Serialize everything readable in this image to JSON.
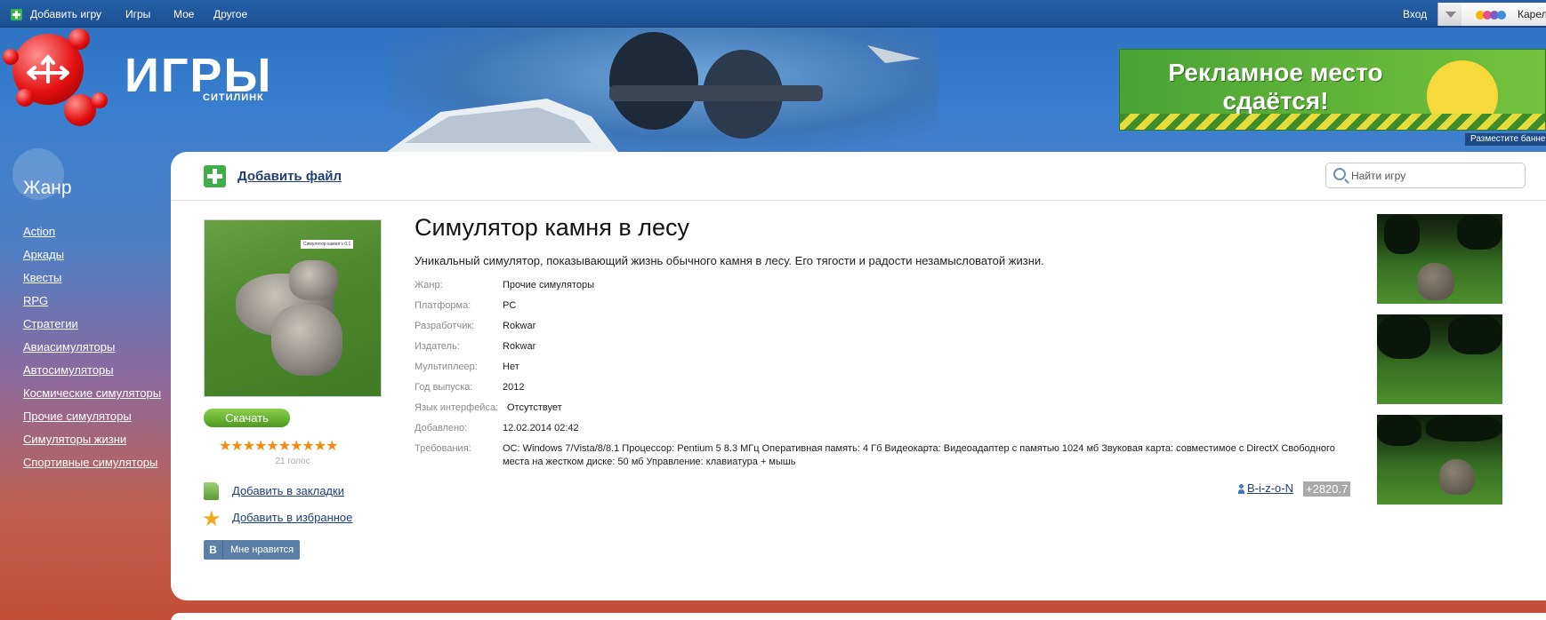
{
  "topbar": {
    "add_game": "Добавить игру",
    "games": "Игры",
    "mine": "Мое",
    "other": "Другое",
    "login": "Вход",
    "region": "Карелия"
  },
  "header": {
    "logo_title": "ИГРЫ",
    "logo_subtitle": "СИТИЛИНК",
    "ad_text": "Рекламное место сдаётся!",
    "ad_note": "Разместите баннер"
  },
  "sidebar": {
    "title": "Жанр",
    "genres": [
      "Action",
      "Аркады",
      "Квесты",
      "RPG",
      "Стратегии",
      "Авиасимуляторы",
      "Автосимуляторы",
      "Космические симуляторы",
      "Прочие симуляторы",
      "Симуляторы жизни",
      "Спортивные симуляторы"
    ]
  },
  "toolbar": {
    "add_file": "Добавить файл",
    "search_placeholder": "Найти игру"
  },
  "game": {
    "cover_label": "Симулятор камня v 0.1",
    "download": "Скачать",
    "rating_stars": 10,
    "votes": "21 голос",
    "add_bookmark": "Добавить в закладки",
    "add_favorite": "Добавить в избранное",
    "vk_logo": "В",
    "vk_like": "Мне нравится",
    "title": "Симулятор камня в лесу",
    "description": "Уникальный симулятор, показывающий жизнь обычного камня в лесу. Его тягости и радости незамысловатой жизни.",
    "info": [
      {
        "key": "Жанр:",
        "value": "Прочие симуляторы"
      },
      {
        "key": "Платформа:",
        "value": "PC"
      },
      {
        "key": "Разработчик:",
        "value": "Rokwar"
      },
      {
        "key": "Издатель:",
        "value": "Rokwar"
      },
      {
        "key": "Мультиплеер:",
        "value": "Нет"
      },
      {
        "key": "Год выпуска:",
        "value": "2012"
      },
      {
        "key": "Язык интерфейса:",
        "value": "Отсутствует"
      },
      {
        "key": "Добавлено:",
        "value": "12.02.2014 02:42"
      },
      {
        "key": "Требования:",
        "value": "ОС: Windows 7/Vista/8/8.1 Процессор: Pentium 5 8.3 МГц Оперативная память: 4 Гб Видеокарта: Видеоадаптер с памятью 1024 мб Звуковая карта: совместимое с DirectX Свободного места на жестком диске: 50 мб Управление: клавиатура + мышь"
      }
    ],
    "author": "B-i-z-o-N",
    "author_rating": "+2820.7"
  },
  "colors": {
    "link": "#1f3f7a",
    "download_green": "#4c9a22",
    "star_orange": "#f08a12",
    "vk_blue": "#5b7fa6"
  }
}
